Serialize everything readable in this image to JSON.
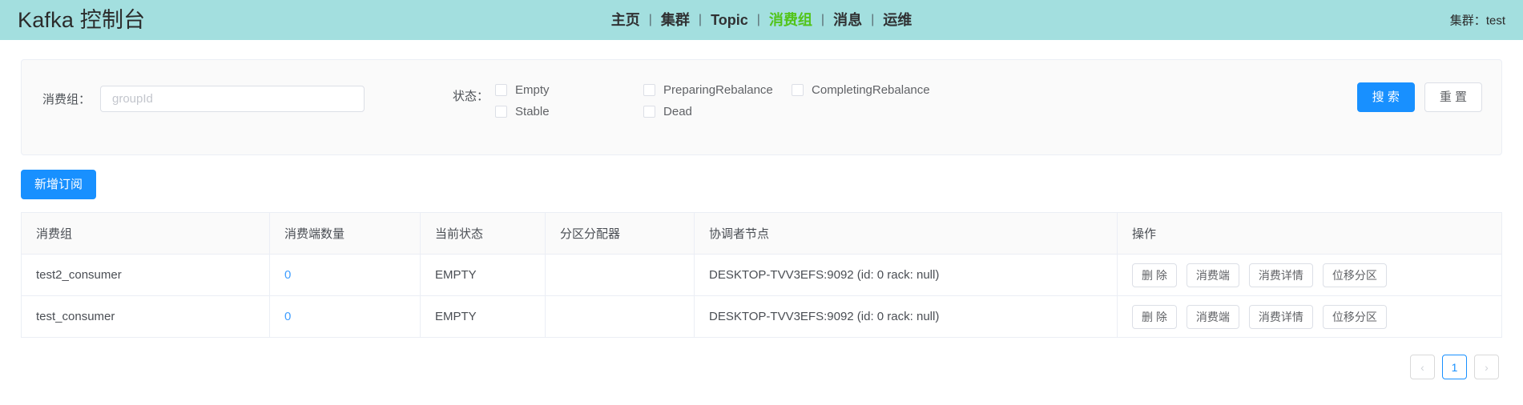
{
  "header": {
    "brand": "Kafka 控制台",
    "nav": [
      {
        "label": "主页",
        "active": false
      },
      {
        "label": "集群",
        "active": false
      },
      {
        "label": "Topic",
        "active": false
      },
      {
        "label": "消费组",
        "active": true
      },
      {
        "label": "消息",
        "active": false
      },
      {
        "label": "运维",
        "active": false
      }
    ],
    "separator": "|",
    "cluster_label": "集群：",
    "cluster_value": "test",
    "bg_color": "#a3dfdf",
    "active_color": "#52c41a"
  },
  "filter": {
    "group_label": "消费组：",
    "group_placeholder": "groupId",
    "group_value": "",
    "status_label": "状态：",
    "statuses": [
      {
        "label": "Empty",
        "checked": false
      },
      {
        "label": "Stable",
        "checked": false
      },
      {
        "label": "PreparingRebalance",
        "checked": false
      },
      {
        "label": "Dead",
        "checked": false
      },
      {
        "label": "CompletingRebalance",
        "checked": false
      }
    ],
    "search_label": "搜 索",
    "reset_label": "重 置"
  },
  "toolbar": {
    "add_label": "新增订阅"
  },
  "table": {
    "columns": [
      "消费组",
      "消费端数量",
      "当前状态",
      "分区分配器",
      "协调者节点",
      "操作"
    ],
    "rows": [
      {
        "group": "test2_consumer",
        "consumers": "0",
        "state": "EMPTY",
        "assignor": "",
        "coordinator": "DESKTOP-TVV3EFS:9092 (id: 0 rack: null)"
      },
      {
        "group": "test_consumer",
        "consumers": "0",
        "state": "EMPTY",
        "assignor": "",
        "coordinator": "DESKTOP-TVV3EFS:9092 (id: 0 rack: null)"
      }
    ],
    "row_actions": [
      "删 除",
      "消费端",
      "消费详情",
      "位移分区"
    ]
  },
  "pagination": {
    "prev_icon": "‹",
    "next_icon": "›",
    "pages": [
      "1"
    ],
    "current": "1"
  },
  "colors": {
    "primary": "#1890ff",
    "link": "#409eff",
    "header_bg": "#a3dfdf"
  }
}
